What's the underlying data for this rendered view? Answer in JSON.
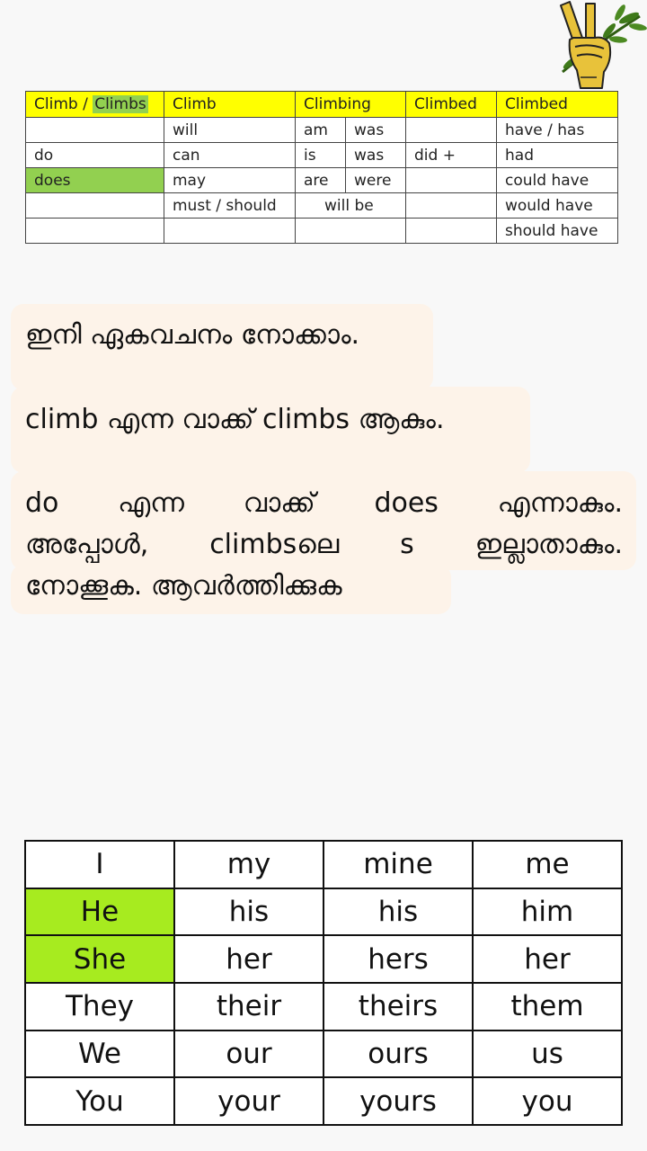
{
  "logo": {
    "icon": "peace-hand-olive-branch-icon"
  },
  "verb_table": {
    "header": [
      {
        "parts": [
          "Climb / ",
          "Climbs"
        ]
      },
      "Climb",
      "Climbing",
      "Climbed",
      "Climbed"
    ],
    "rows": [
      [
        "",
        "will",
        "am",
        "was",
        "",
        "have / has"
      ],
      [
        "do",
        "can",
        "is",
        "was",
        "did +",
        "had"
      ],
      [
        "does",
        "may",
        "are",
        "were",
        "",
        "could have"
      ],
      [
        "",
        "must / should",
        "will be",
        "",
        "would have"
      ],
      [
        "",
        "",
        "",
        "",
        "should have"
      ]
    ]
  },
  "text": {
    "line1": "ഇനി ഏകവചനം നോക്കാം.",
    "line2": "climb എന്ന വാക്ക് climbs ആകും.",
    "line3_words": [
      "do",
      "എന്ന",
      "വാക്ക്",
      "does",
      "എന്നാകും."
    ],
    "line4_words": [
      "അപ്പോൾ,",
      "climbsലെ",
      "s",
      "ഇല്ലാതാകും."
    ],
    "line5": "നോക്കൂക. ആവർത്തിക്കുക"
  },
  "pronoun_table": {
    "rows": [
      [
        "I",
        "my",
        "mine",
        "me"
      ],
      [
        "He",
        "his",
        "his",
        "him"
      ],
      [
        "She",
        "her",
        "hers",
        "her"
      ],
      [
        "They",
        "their",
        "theirs",
        "them"
      ],
      [
        "We",
        "our",
        "ours",
        "us"
      ],
      [
        "You",
        "your",
        "yours",
        "you"
      ]
    ],
    "highlight_color": "#a7eb1f"
  },
  "colors": {
    "header_yellow": "#ffff00",
    "green": "#92d050",
    "text_bg": "#fdf3e9"
  }
}
